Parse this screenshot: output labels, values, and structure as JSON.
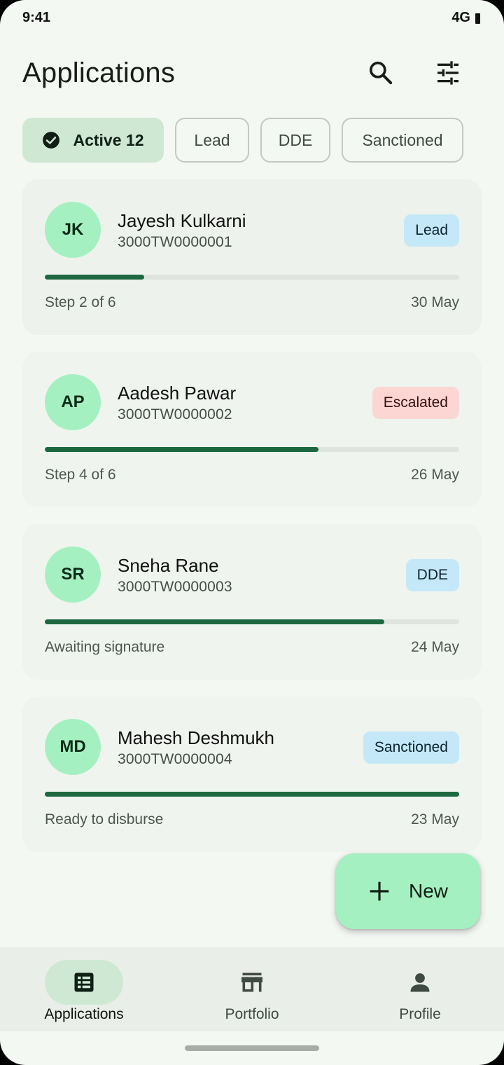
{
  "status_bar": {
    "time": "9:41",
    "network": "4G"
  },
  "header": {
    "title": "Applications"
  },
  "chips": [
    {
      "label": "Active 12",
      "selected": true
    },
    {
      "label": "Lead",
      "selected": false
    },
    {
      "label": "DDE",
      "selected": false
    },
    {
      "label": "Sanctioned",
      "selected": false
    }
  ],
  "applications": [
    {
      "initials": "JK",
      "name": "Jayesh Kulkarni",
      "id": "3000TW0000001",
      "status": "Lead",
      "status_color": "#c4e8f7",
      "step": "Step 2 of 6",
      "date": "30 May",
      "progress": 0.24
    },
    {
      "initials": "AP",
      "name": "Aadesh Pawar",
      "id": "3000TW0000002",
      "status": "Escalated",
      "status_color": "#fbd6d3",
      "step": "Step 4 of 6",
      "date": "26 May",
      "progress": 0.66
    },
    {
      "initials": "SR",
      "name": "Sneha Rane",
      "id": "3000TW0000003",
      "status": "DDE",
      "status_color": "#c4e8f7",
      "step": "Awaiting signature",
      "date": "24 May",
      "progress": 0.82
    },
    {
      "initials": "MD",
      "name": "Mahesh Deshmukh",
      "id": "3000TW0000004",
      "status": "Sanctioned",
      "status_color": "#c4e8f7",
      "step": "Ready to disburse",
      "date": "23 May",
      "progress": 1.0
    }
  ],
  "fab": {
    "label": "New"
  },
  "nav": [
    {
      "label": "Applications",
      "icon": "grid-list-icon",
      "active": true
    },
    {
      "label": "Portfolio",
      "icon": "storefront-icon",
      "active": false
    },
    {
      "label": "Profile",
      "icon": "person-icon",
      "active": false
    }
  ],
  "colors": {
    "accent": "#1e6840",
    "primary_container": "#a5f0c1",
    "secondary_container": "#cfe8d4"
  }
}
